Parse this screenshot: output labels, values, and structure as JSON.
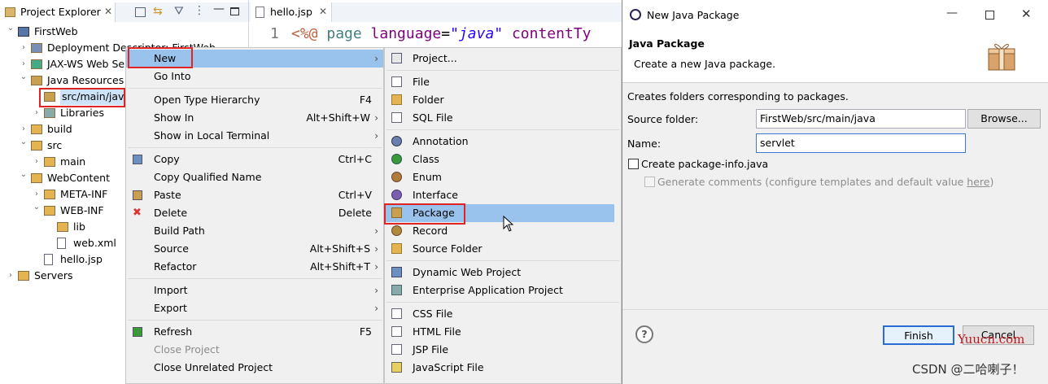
{
  "explorer": {
    "tab_label": "Project Explorer",
    "tree": [
      {
        "label": "FirstWeb",
        "icon": "project-icon",
        "twisty": "v"
      },
      {
        "label": "Deployment Descriptor: FirstWeb",
        "icon": "descriptor-icon",
        "twisty": ">"
      },
      {
        "label": "JAX-WS Web Services",
        "icon": "webservice-icon",
        "twisty": ">"
      },
      {
        "label": "Java Resources",
        "icon": "java-resources-icon",
        "twisty": "v"
      },
      {
        "label": "src/main/java",
        "icon": "package-folder-icon",
        "twisty": ""
      },
      {
        "label": "Libraries",
        "icon": "libraries-icon",
        "twisty": ">"
      },
      {
        "label": "build",
        "icon": "folder-icon",
        "twisty": ">"
      },
      {
        "label": "src",
        "icon": "folder-icon",
        "twisty": "v"
      },
      {
        "label": "main",
        "icon": "folder-icon",
        "twisty": ">"
      },
      {
        "label": "WebContent",
        "icon": "folder-icon",
        "twisty": "v"
      },
      {
        "label": "META-INF",
        "icon": "folder-icon",
        "twisty": ">"
      },
      {
        "label": "WEB-INF",
        "icon": "folder-icon",
        "twisty": "v"
      },
      {
        "label": "lib",
        "icon": "folder-icon",
        "twisty": ""
      },
      {
        "label": "web.xml",
        "icon": "xml-file-icon",
        "twisty": ""
      },
      {
        "label": "hello.jsp",
        "icon": "jsp-file-icon",
        "twisty": ""
      },
      {
        "label": "Servers",
        "icon": "folder-icon",
        "twisty": ">"
      }
    ]
  },
  "editor": {
    "tab_label": "hello.jsp",
    "line_number": "1",
    "code": {
      "lt": "<%@",
      "kw": " page ",
      "attr": "language",
      "eq": "=",
      "val": "\"java\"",
      "rest": " contentTy"
    }
  },
  "context_menu": {
    "items": [
      {
        "label": "New",
        "shortcut": "",
        "arrow": "›",
        "icon": ""
      },
      {
        "label": "Go Into",
        "shortcut": "",
        "arrow": "",
        "icon": ""
      },
      {
        "label": "Open Type Hierarchy",
        "shortcut": "F4",
        "arrow": "",
        "icon": ""
      },
      {
        "label": "Show In",
        "shortcut": "Alt+Shift+W",
        "arrow": "›",
        "icon": ""
      },
      {
        "label": "Show in Local Terminal",
        "shortcut": "",
        "arrow": "›",
        "icon": ""
      },
      {
        "label": "Copy",
        "shortcut": "Ctrl+C",
        "arrow": "",
        "icon": "copy-icon"
      },
      {
        "label": "Copy Qualified Name",
        "shortcut": "",
        "arrow": "",
        "icon": ""
      },
      {
        "label": "Paste",
        "shortcut": "Ctrl+V",
        "arrow": "",
        "icon": "paste-icon"
      },
      {
        "label": "Delete",
        "shortcut": "Delete",
        "arrow": "",
        "icon": "delete-icon"
      },
      {
        "label": "Build Path",
        "shortcut": "",
        "arrow": "›",
        "icon": ""
      },
      {
        "label": "Source",
        "shortcut": "Alt+Shift+S",
        "arrow": "›",
        "icon": ""
      },
      {
        "label": "Refactor",
        "shortcut": "Alt+Shift+T",
        "arrow": "›",
        "icon": ""
      },
      {
        "label": "Import",
        "shortcut": "",
        "arrow": "›",
        "icon": ""
      },
      {
        "label": "Export",
        "shortcut": "",
        "arrow": "›",
        "icon": ""
      },
      {
        "label": "Refresh",
        "shortcut": "F5",
        "arrow": "",
        "icon": "refresh-icon"
      },
      {
        "label": "Close Project",
        "shortcut": "",
        "arrow": "",
        "icon": ""
      },
      {
        "label": "Close Unrelated Project",
        "shortcut": "",
        "arrow": "",
        "icon": ""
      }
    ]
  },
  "submenu": {
    "items": [
      {
        "label": "Project...",
        "icon": "new-project-icon"
      },
      {
        "label": "File",
        "icon": "file-icon"
      },
      {
        "label": "Folder",
        "icon": "folder-icon"
      },
      {
        "label": "SQL File",
        "icon": "sql-file-icon"
      },
      {
        "label": "Annotation",
        "icon": "annotation-icon"
      },
      {
        "label": "Class",
        "icon": "class-icon"
      },
      {
        "label": "Enum",
        "icon": "enum-icon"
      },
      {
        "label": "Interface",
        "icon": "interface-icon"
      },
      {
        "label": "Package",
        "icon": "package-icon"
      },
      {
        "label": "Record",
        "icon": "record-icon"
      },
      {
        "label": "Source Folder",
        "icon": "source-folder-icon"
      },
      {
        "label": "Dynamic Web Project",
        "icon": "web-project-icon"
      },
      {
        "label": "Enterprise Application Project",
        "icon": "ear-project-icon"
      },
      {
        "label": "CSS File",
        "icon": "css-file-icon"
      },
      {
        "label": "HTML File",
        "icon": "html-file-icon"
      },
      {
        "label": "JSP File",
        "icon": "jsp-file-icon"
      },
      {
        "label": "JavaScript File",
        "icon": "js-file-icon"
      }
    ]
  },
  "dialog": {
    "title": "New Java Package",
    "heading": "Java Package",
    "subheading": "Create a new Java package.",
    "description": "Creates folders corresponding to packages.",
    "source_folder_label": "Source folder:",
    "source_folder_value": "FirstWeb/src/main/java",
    "browse_label": "Browse...",
    "name_label": "Name:",
    "name_value": "servlet",
    "create_info_label": "Create package-info.java",
    "generate_comments_label": "Generate comments (configure templates and default value ",
    "here_link": "here",
    "generate_comments_close": ")",
    "finish_label": "Finish",
    "cancel_label": "Cancel"
  },
  "watermarks": {
    "yuucn": "Yuucn.com",
    "csdn": "CSDN @二哈喇子！"
  },
  "colors": {
    "highlight": "#99c3ec",
    "redbox": "#e02424",
    "keyword": "#7f0055",
    "string": "#2a00ff",
    "attr": "#7f007f"
  }
}
